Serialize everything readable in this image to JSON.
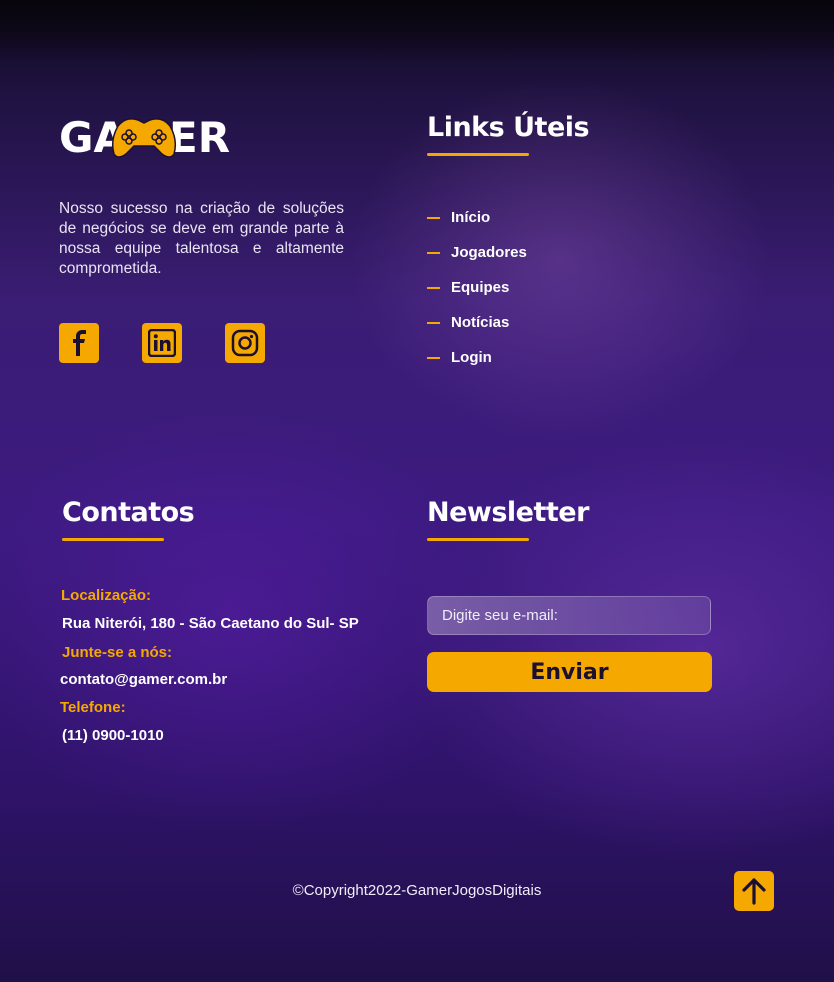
{
  "brand": {
    "logo_text": "GAMER"
  },
  "about": {
    "text": "Nosso sucesso na criação de soluções de negócios se deve em grande parte à nossa equipe talentosa e altamente comprometida."
  },
  "social": [
    "facebook-icon",
    "linkedin-icon",
    "instagram-icon"
  ],
  "links": {
    "title": "Links Úteis",
    "items": [
      {
        "label": "Início"
      },
      {
        "label": "Jogadores"
      },
      {
        "label": "Equipes"
      },
      {
        "label": "Notícias"
      },
      {
        "label": "Login"
      }
    ]
  },
  "contacts": {
    "title": "Contatos",
    "location_label": "Localização:",
    "location_value": "Rua Niterói, 180 - São Caetano do Sul- SP",
    "join_label": "Junte-se a nós:",
    "join_value": "contato@gamer.com.br",
    "phone_label": "Telefone:",
    "phone_value": "(11) 0900-1010"
  },
  "newsletter": {
    "title": "Newsletter",
    "placeholder": "Digite seu e-mail:",
    "button_label": "Enviar"
  },
  "footer": {
    "copyright": "©Copyright2022-GamerJogosDigitais"
  },
  "colors": {
    "accent": "#f5a800",
    "background": "#3a1d74"
  }
}
